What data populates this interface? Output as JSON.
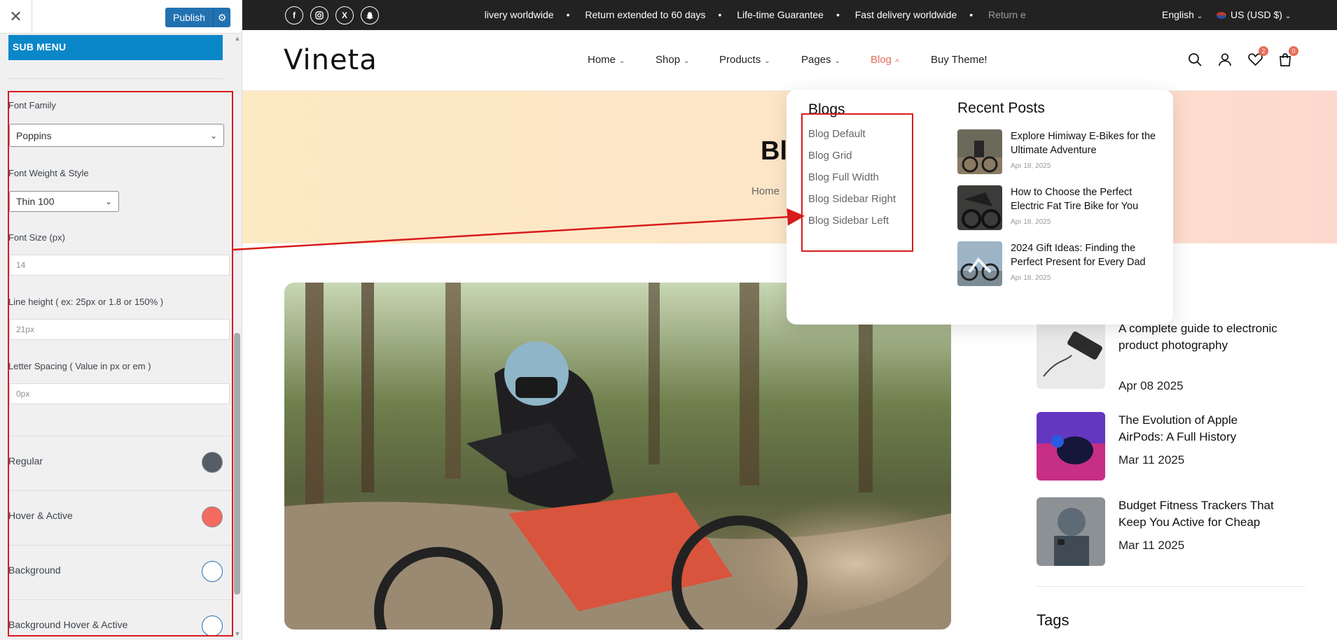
{
  "customizer": {
    "close_icon": "close-icon",
    "publish_label": "Publish",
    "section_title": "SUB MENU",
    "font_family": {
      "label": "Font Family",
      "value": "Poppins"
    },
    "font_weight": {
      "label": "Font Weight & Style",
      "value": "Thin 100"
    },
    "font_size": {
      "label": "Font Size (px)",
      "placeholder": "14"
    },
    "line_height": {
      "label": "Line height ( ex: 25px or 1.8 or 150% )",
      "placeholder": "21px"
    },
    "letter_spacing": {
      "label": "Letter Spacing ( Value in px or em )",
      "placeholder": "0px"
    },
    "colors": [
      {
        "label": "Regular",
        "color": "#555d66"
      },
      {
        "label": "Hover & Active",
        "color": "#f26b5e"
      },
      {
        "label": "Background",
        "color": "#ffffff"
      },
      {
        "label": "Background Hover & Active",
        "color": "#ffffff"
      }
    ]
  },
  "site": {
    "topbar": {
      "socials": [
        "f",
        "ig",
        "X",
        "sc"
      ],
      "marquee": [
        "elivery worldwide",
        "Return extended to 60 days",
        "Life-time Guarantee",
        "Fast delivery worldwide",
        "Return e"
      ],
      "language": "English",
      "currency": "US (USD $)"
    },
    "logo": "Vineta",
    "nav": {
      "home": "Home",
      "shop": "Shop",
      "products": "Products",
      "pages": "Pages",
      "blog": "Blog",
      "buy": "Buy Theme!"
    },
    "wishlist_count": "2",
    "cart_count": "0",
    "banner": {
      "title": "Blo",
      "crumb": "Home"
    },
    "mega_menu": {
      "blogs_title": "Blogs",
      "links": [
        "Blog Default",
        "Blog Grid",
        "Blog Full Width",
        "Blog Sidebar Right",
        "Blog Sidebar Left"
      ],
      "recent_title": "Recent Posts",
      "posts": [
        {
          "title": "Explore Himiway E-Bikes for the Ultimate Adventure",
          "date": "Apr 18, 2025"
        },
        {
          "title": "How to Choose the Perfect Electric Fat Tire Bike for You",
          "date": "Apr 18, 2025"
        },
        {
          "title": "2024 Gift Ideas: Finding the Perfect Present for Every Dad",
          "date": "Apr 18, 2025"
        }
      ]
    },
    "sidebar_posts": [
      {
        "title": "A complete guide to electronic product photography",
        "date": "Apr 08 2025"
      },
      {
        "title": "The Evolution of Apple AirPods: A Full History",
        "date": "Mar 11 2025"
      },
      {
        "title": "Budget Fitness Trackers That Keep You Active for Cheap",
        "date": "Mar 11 2025"
      }
    ],
    "tags_title": "Tags"
  }
}
